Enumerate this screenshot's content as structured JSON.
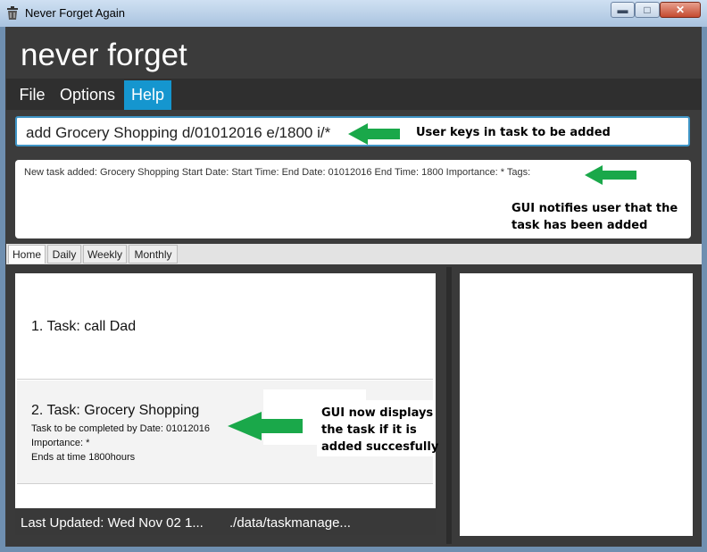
{
  "window": {
    "title": "Never Forget Again",
    "app_icon": "trash-bin-icon",
    "minimize_icon": "minimize-icon",
    "maximize_icon": "maximize-icon",
    "close_icon": "close-icon"
  },
  "header": {
    "title": "never forget"
  },
  "menu": {
    "items": [
      "File",
      "Options",
      "Help"
    ],
    "active": "Help"
  },
  "command": {
    "value": "add Grocery Shopping d/01012016 e/1800 i/*"
  },
  "feedback": {
    "text": "New task added: Grocery Shopping Start Date:  Start Time:  End Date: 01012016 End Time: 1800 Importance: * Tags:"
  },
  "tabs": [
    "Home",
    "Daily",
    "Weekly",
    "Monthly"
  ],
  "tasks": [
    {
      "title": "1. Task: call Dad"
    },
    {
      "title": "2. Task: Grocery Shopping",
      "details": [
        "Task to be completed by Date: 01012016",
        "Importance: *",
        "Ends at time 1800hours"
      ]
    }
  ],
  "status": {
    "last_updated": "Last Updated: Wed Nov 02 1...",
    "path": "./data/taskmanage..."
  },
  "annotations": {
    "input_note": "User keys in task to be added",
    "feedback_note": [
      "GUI notifies user that the",
      "task has been added"
    ],
    "display_note": [
      "GUI now displays",
      "the task if it is",
      "added succesfully"
    ],
    "arrow_color": "#1aa84a"
  },
  "colors": {
    "accent": "#1596cf",
    "dark": "#3b3b3b"
  }
}
